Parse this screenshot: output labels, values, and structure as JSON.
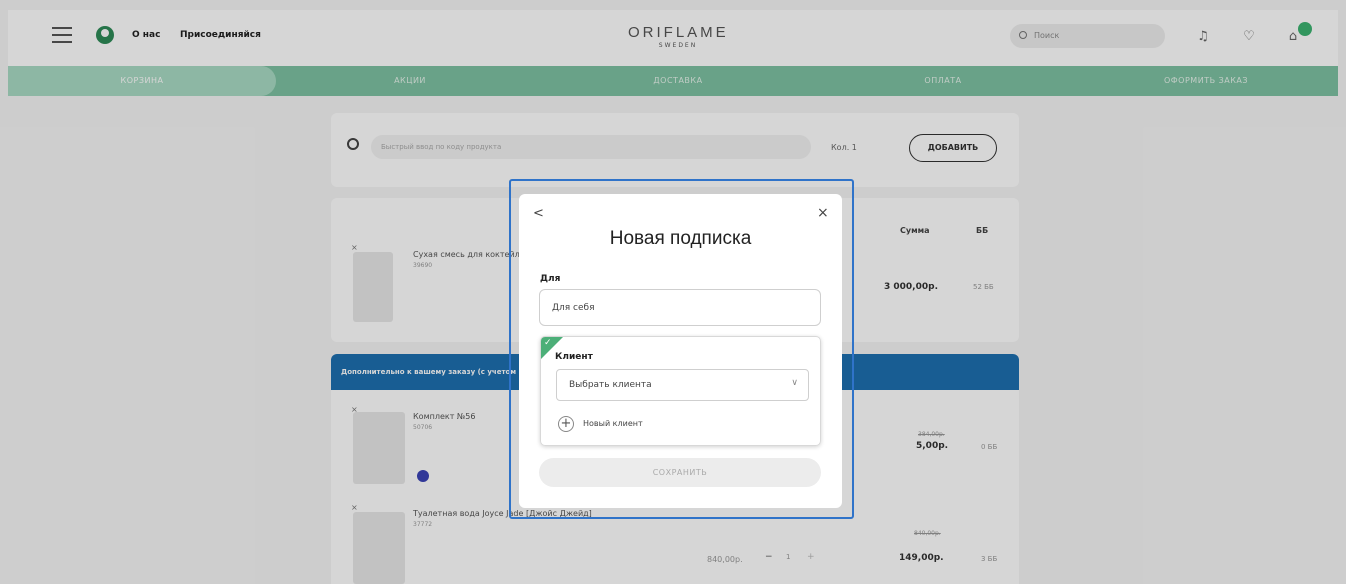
{
  "header": {
    "nav_about": "О нас",
    "nav_join": "Присоединяйся",
    "logo_main": "ORIFLAME",
    "logo_sub": "SWEDEN",
    "search_placeholder": "Поиск"
  },
  "steps": [
    "КОРЗИНА",
    "АКЦИИ",
    "ДОСТАВКА",
    "ОПЛАТА",
    "ОФОРМИТЬ ЗАКАЗ"
  ],
  "quick_add": {
    "placeholder": "Быстрый ввод по коду продукта",
    "qty_label": "Кол. 1",
    "add_button": "ДОБАВИТЬ"
  },
  "cart": {
    "col_sum": "Сумма",
    "col_bb": "ББ",
    "item1": {
      "name": "Сухая смесь для коктейля",
      "code": "39690",
      "sum": "3 000,00р.",
      "bb": "52 ББ"
    }
  },
  "extras": {
    "banner": "Дополнительно к вашему заказу (с учетом",
    "item1": {
      "name": "Комплект №56",
      "code": "50706",
      "old_price": "384,00р.",
      "price": "5,00р.",
      "bb": "0 ББ"
    },
    "item2": {
      "name": "Туалетная вода Joyce Jade [Джойс Джейд]",
      "code": "37772",
      "unit": "840,00р.",
      "qty": "1",
      "old_price": "840,00р.",
      "price": "149,00р.",
      "bb": "3 ББ"
    }
  },
  "modal": {
    "title": "Новая подписка",
    "for_label": "Для",
    "for_value": "Для себя",
    "client_label": "Клиент",
    "client_select": "Выбрать клиента",
    "new_client": "Новый клиент",
    "save_button": "СОХРАНИТЬ"
  },
  "colors": {
    "accent_green": "#7ec2a2",
    "brand_blue": "#1d6fb0",
    "highlight": "#2f73c9"
  }
}
